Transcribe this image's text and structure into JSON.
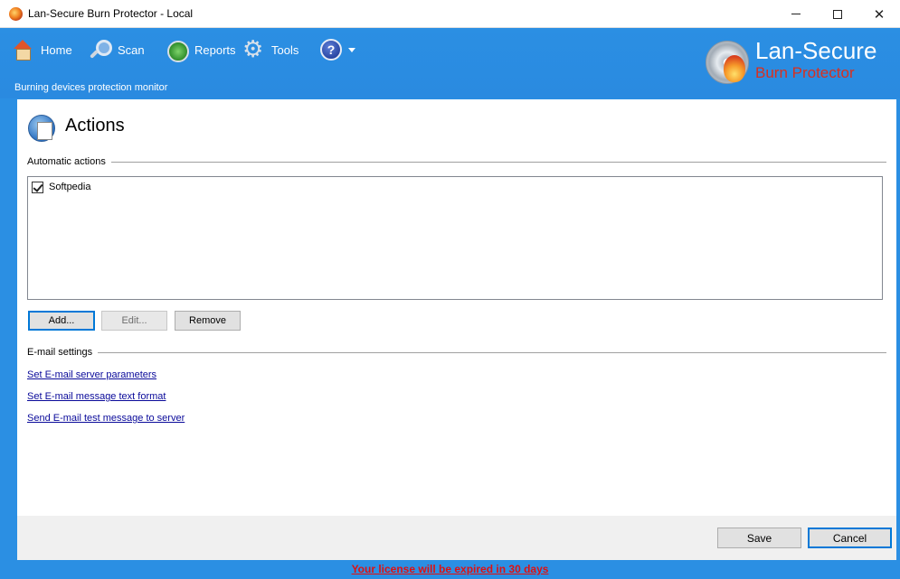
{
  "window": {
    "title": "Lan-Secure Burn Protector - Local",
    "minimize": "—",
    "maximize": "☐",
    "close": "✕"
  },
  "toolbar": {
    "items": [
      {
        "label": "Home",
        "icon": "home-icon"
      },
      {
        "label": "Scan",
        "icon": "magnifier-icon"
      },
      {
        "label": "Reports",
        "icon": "reports-icon"
      },
      {
        "label": "Tools",
        "icon": "gear-icon"
      }
    ],
    "help_glyph": "?",
    "subtitle": "Burning devices protection monitor"
  },
  "brand": {
    "title": "Lan-Secure",
    "subtitle": "Burn Protector",
    "subtitle_color": "#d8301f"
  },
  "panel": {
    "title": "Actions",
    "automatic_actions": {
      "label": "Automatic actions",
      "items": [
        {
          "label": "Softpedia",
          "checked": true
        }
      ],
      "buttons": {
        "add": "Add...",
        "edit": "Edit...",
        "remove": "Remove"
      }
    },
    "email_settings": {
      "label": "E-mail settings",
      "links": [
        "Set E-mail server parameters",
        "Set E-mail message text format",
        "Send E-mail test message to server"
      ]
    },
    "footer": {
      "save": "Save",
      "cancel": "Cancel"
    }
  },
  "status": {
    "license": "Your license will be expired in 30 days",
    "color": "#e01010"
  },
  "colors": {
    "frame_blue": "#2b8fe3"
  }
}
